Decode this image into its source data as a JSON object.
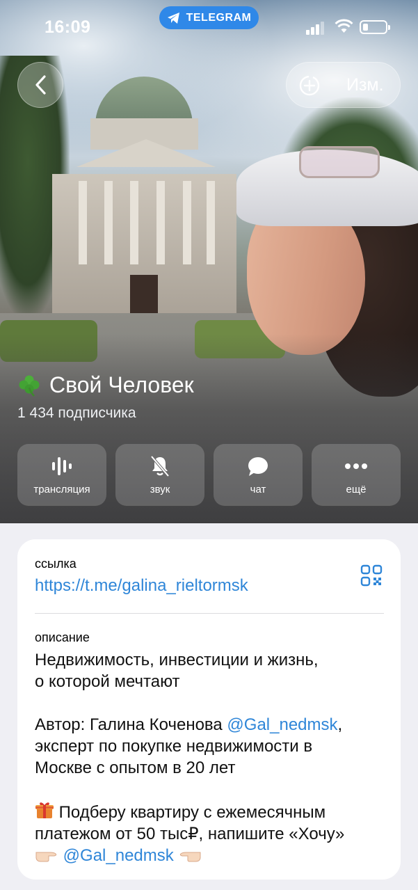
{
  "statusbar": {
    "time": "16:09",
    "pill_label": "TELEGRAM",
    "signal_bars": 3,
    "battery_level": 0.25
  },
  "header": {
    "back_icon": "chevron-left-icon",
    "edit_icon": "add-circle-icon",
    "edit_label": "Изм."
  },
  "channel": {
    "emoji": "clover-icon",
    "name": "Свой Человек",
    "subscribers": "1 434 подписчика"
  },
  "actions": [
    {
      "icon": "broadcast-icon",
      "label": "трансляция"
    },
    {
      "icon": "bell-muted-icon",
      "label": "звук"
    },
    {
      "icon": "chat-bubble-icon",
      "label": "чат"
    },
    {
      "icon": "more-icon",
      "label": "ещё"
    }
  ],
  "info": {
    "link_label": "ссылка",
    "link_url": "https://t.me/galina_rieltormsk",
    "qr_icon": "qr-code-icon",
    "description_label": "описание",
    "description": {
      "line1": "Недвижимость, инвестиции и жизнь,",
      "line2": "о которой мечтают",
      "author_prefix": "Автор: Галина Коченова ",
      "author_mention": "@Gal_nedmsk",
      "author_suffix": ",",
      "line4": "эксперт по покупке недвижимости в",
      "line5": "Москве с опытом в 20 лет",
      "offer_emoji": "gift-icon",
      "offer_line1": " Подберу квартиру с ежемесячным",
      "offer_line2": "платежом от 50 тыс₽, напишите «Хочу»",
      "pointer_right": "pointing-right-hand-icon",
      "offer_mention": "@Gal_nedmsk",
      "pointer_left": "pointing-left-hand-icon"
    }
  }
}
